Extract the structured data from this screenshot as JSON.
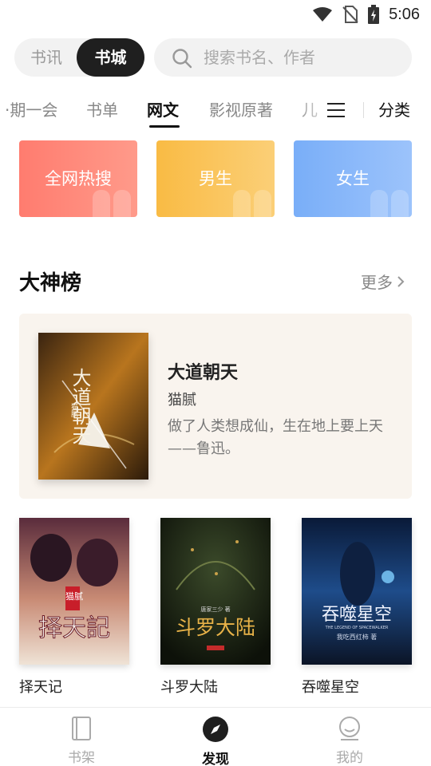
{
  "status_bar": {
    "time": "5:06",
    "icons": [
      "wifi-icon",
      "no-sim-icon",
      "battery-charging-icon"
    ]
  },
  "header": {
    "segments": {
      "news": "书讯",
      "store": "书城",
      "selected": "书城"
    },
    "search": {
      "placeholder": "搜索书名、作者",
      "icon": "search-icon"
    }
  },
  "tabs": {
    "items": [
      "·期一会",
      "书单",
      "网文",
      "影视原著",
      "儿"
    ],
    "active": "网文",
    "menu_icon": "menu-icon",
    "category_label": "分类"
  },
  "category_cards": [
    {
      "label": "全网热搜",
      "color": "#ff7f72"
    },
    {
      "label": "男生",
      "color": "#f9bb44"
    },
    {
      "label": "女生",
      "color": "#79aef8"
    }
  ],
  "section": {
    "title": "大神榜",
    "more": "更多"
  },
  "featured_book": {
    "title": "大道朝天",
    "author": "猫腻",
    "description": "做了人类想成仙，生在地上要上天——鲁迅。",
    "cover_text": "大道朝天",
    "cover_author": "猫腻"
  },
  "books": [
    {
      "title": "择天记",
      "cover_text": "择天記",
      "cover_tag": "猫腻"
    },
    {
      "title": "斗罗大陆",
      "cover_text": "斗罗大陆",
      "cover_tag": "唐家三少 著"
    },
    {
      "title": "吞噬星空",
      "cover_text": "吞噬星空",
      "cover_tag": "THE LEGEND OF SPACEWALKER",
      "cover_author": "我吃西红柿 著"
    }
  ],
  "bottom_nav": {
    "items": [
      {
        "label": "书架",
        "icon": "bookshelf-icon"
      },
      {
        "label": "发现",
        "icon": "compass-icon"
      },
      {
        "label": "我的",
        "icon": "profile-icon"
      }
    ],
    "active": "发现"
  }
}
